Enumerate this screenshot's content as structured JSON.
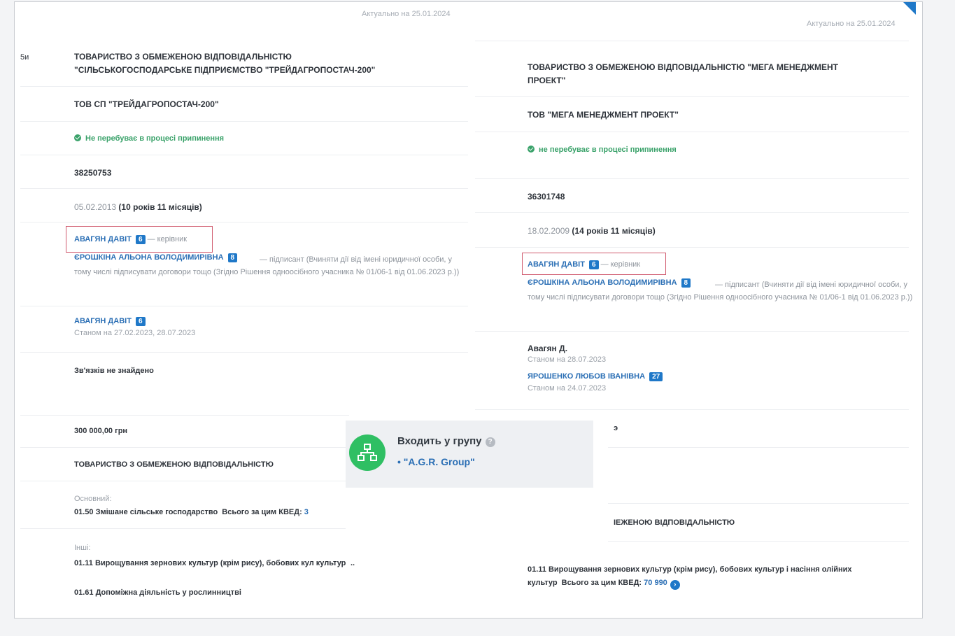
{
  "left": {
    "actual": "Актуально на 25.01.2024",
    "edge_label": "5и",
    "full_name_line1": "ТОВАРИСТВО З ОБМЕЖЕНОЮ ВІДПОВІДАЛЬНІСТЮ",
    "full_name_line2": "\"СІЛЬСЬКОГОСПОДАРСЬКЕ ПІДПРИЄМСТВО \"ТРЕЙДАГРОПОСТАЧ-200\"",
    "short_name": "ТОВ СП \"ТРЕЙДАГРОПОСТАЧ-200\"",
    "status": "Не перебуває в процесі припинення",
    "code": "38250753",
    "reg_date": "05.02.2013",
    "reg_age": "(10 років 11 місяців)",
    "director_name": "АВАГЯН ДАВІТ",
    "director_badge": "6",
    "director_role": "— керівник",
    "signer_name": "ЄРОШКІНА АЛЬОНА ВОЛОДИМИРІВНА",
    "signer_badge": "8",
    "signer_role": "— підписант (Вчиняти дії від імені юридичної особи, у тому числі підписувати договори тощо (Згідно Рішення одноосібного учасника № 01/06-1 від 01.06.2023 р.))",
    "founder_name": "АВАГЯН ДАВІТ",
    "founder_badge": "6",
    "founder_date": "Станом на 27.02.2023, 28.07.2023",
    "links": "Зв'язків не знайдено",
    "capital": "300 000,00 грн",
    "legal_form": "ТОВАРИСТВО З ОБМЕЖЕНОЮ ВІДПОВІДАЛЬНІСТЮ",
    "kved_main_label": "Основний:",
    "kved_main": "01.50 Змішане сільське господарство",
    "kved_main_total_label": "Всього за цим КВЕД:",
    "kved_main_total": "3",
    "kved_other_label": "Інші:",
    "kved_other_1": "01.11 Вирощування зернових культур (крім рису), бобових кул культур",
    "kved_other_more": "..",
    "kved_other_2": "01.61 Допоміжна діяльність у рослинництві"
  },
  "right": {
    "actual": "Актуально на 25.01.2024",
    "full_name_line1": "ТОВАРИСТВО З ОБМЕЖЕНОЮ ВІДПОВІДАЛЬНІСТЮ \"МЕГА МЕНЕДЖМЕНТ",
    "full_name_line2": "ПРОЕКТ\"",
    "short_name": "ТОВ \"МЕГА МЕНЕДЖМЕНТ ПРОЕКТ\"",
    "status": "не перебуває в процесі припинення",
    "code": "36301748",
    "reg_date": "18.02.2009",
    "reg_age": "(14 років 11 місяців)",
    "director_name": "АВАГЯН ДАВІТ",
    "director_badge": "6",
    "director_role": "— керівник",
    "signer_name": "ЄРОШКІНА АЛЬОНА ВОЛОДИМИРІВНА",
    "signer_badge": "8",
    "signer_role": "— підписант (Вчиняти дії від імені юридичної особи, у тому числі підписувати договори тощо (Згідно Рішення одноосібного учасника № 01/06-1 від 01.06.2023 р.))",
    "founder1_name": "Авагян Д.",
    "founder1_date": "Станом на 28.07.2023",
    "founder2_name": "ЯРОШЕНКО ЛЮБОВ ІВАНІВНА",
    "founder2_badge": "27",
    "founder2_date": "Станом на 24.07.2023",
    "capital_fragment": "э",
    "legal_form_fragment": "ІЕЖЕНОЮ ВІДПОВІДАЛЬНІСТЮ",
    "kved_1": "01.11 Вирощування зернових культур (крім рису), бобових культур і насіння олійних",
    "kved_1_cont": "культур",
    "kved_total_label": "Всього за цим КВЕД:",
    "kved_total": "70 990"
  },
  "group": {
    "title": "Входить у групу",
    "item": "\"A.G.R. Group\""
  },
  "icons": {
    "status": "check-circle-icon",
    "group": "sitemap-icon",
    "help": "question-icon",
    "info": "chevron-right-icon"
  }
}
